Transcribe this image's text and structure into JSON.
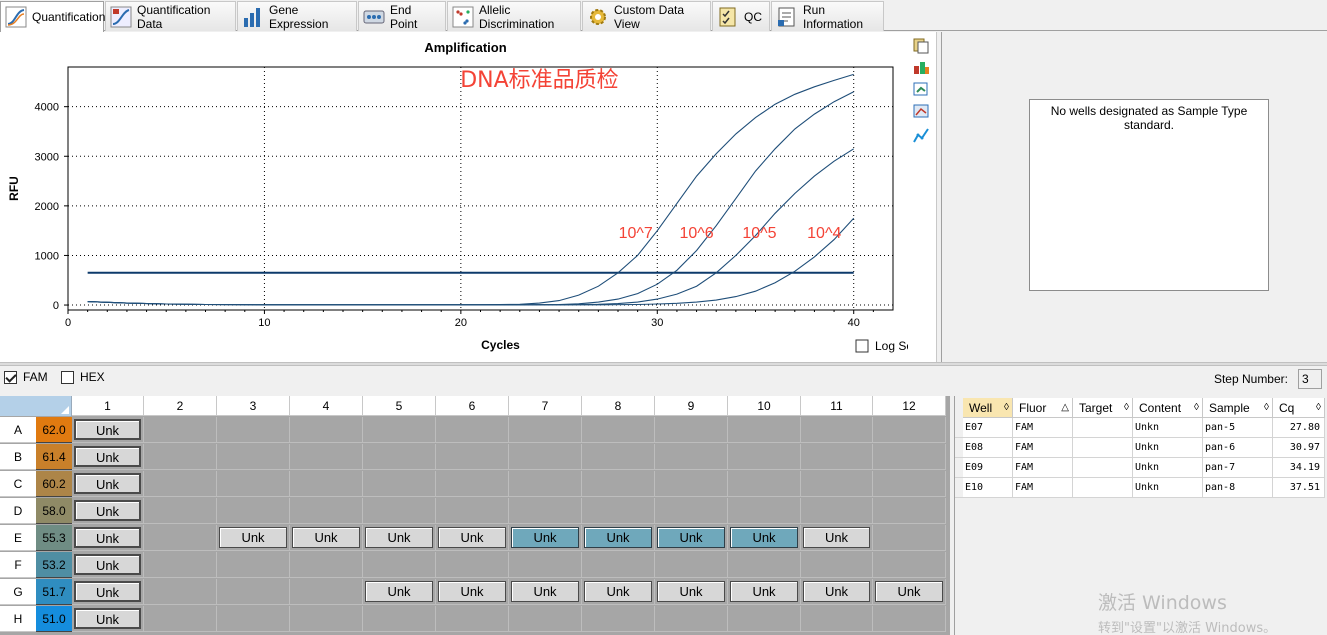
{
  "tabs": [
    {
      "label": "Quantification",
      "icon": "amplification-curve-icon",
      "active": true
    },
    {
      "label": "Quantification Data",
      "icon": "quantification-data-icon"
    },
    {
      "label": "Gene Expression",
      "icon": "bar-chart-icon"
    },
    {
      "label": "End Point",
      "icon": "end-point-icon"
    },
    {
      "label": "Allelic Discrimination",
      "icon": "scatter-plot-icon"
    },
    {
      "label": "Custom Data View",
      "icon": "gear-icon"
    },
    {
      "label": "QC",
      "icon": "checklist-icon"
    },
    {
      "label": "Run Information",
      "icon": "document-icon"
    }
  ],
  "chart_data": {
    "type": "line",
    "title": "Amplification",
    "xlabel": "Cycles",
    "ylabel": "RFU",
    "xlim": [
      0,
      42
    ],
    "ylim": [
      -100,
      4800
    ],
    "x_ticks": [
      0,
      10,
      20,
      30,
      40
    ],
    "y_ticks": [
      0,
      1000,
      2000,
      3000,
      4000
    ],
    "grid": true,
    "annotation_title": "DNA标准品质检",
    "threshold": 650,
    "series": [
      {
        "name": "10^7",
        "x": [
          1,
          3,
          5,
          7,
          10,
          13,
          16,
          19,
          21,
          23,
          24,
          25,
          26,
          27,
          28,
          29,
          30,
          31,
          32,
          33,
          34,
          35,
          36,
          37,
          38,
          39,
          40
        ],
        "y": [
          70,
          40,
          20,
          10,
          5,
          5,
          5,
          5,
          5,
          15,
          40,
          90,
          200,
          380,
          650,
          1000,
          1500,
          2050,
          2600,
          3050,
          3450,
          3780,
          4050,
          4250,
          4400,
          4530,
          4650
        ]
      },
      {
        "name": "10^6",
        "x": [
          1,
          3,
          5,
          7,
          10,
          13,
          16,
          19,
          21,
          23,
          25,
          26,
          27,
          28,
          29,
          30,
          31,
          32,
          33,
          34,
          35,
          36,
          37,
          38,
          39,
          40
        ],
        "y": [
          70,
          40,
          20,
          10,
          5,
          5,
          5,
          5,
          5,
          5,
          10,
          25,
          60,
          120,
          230,
          420,
          700,
          1100,
          1600,
          2150,
          2700,
          3150,
          3550,
          3850,
          4100,
          4300
        ]
      },
      {
        "name": "10^5",
        "x": [
          1,
          3,
          5,
          7,
          10,
          13,
          16,
          19,
          21,
          23,
          25,
          27,
          28,
          29,
          30,
          31,
          32,
          33,
          34,
          35,
          36,
          37,
          38,
          39,
          40
        ],
        "y": [
          70,
          40,
          20,
          10,
          5,
          5,
          5,
          5,
          5,
          5,
          5,
          15,
          30,
          60,
          120,
          220,
          380,
          650,
          1000,
          1400,
          1850,
          2250,
          2600,
          2900,
          3150
        ]
      },
      {
        "name": "10^4",
        "x": [
          1,
          3,
          5,
          7,
          10,
          13,
          16,
          19,
          21,
          23,
          25,
          27,
          29,
          30,
          31,
          32,
          33,
          34,
          35,
          36,
          37,
          38,
          39,
          40
        ],
        "y": [
          70,
          40,
          20,
          10,
          5,
          5,
          5,
          5,
          5,
          5,
          5,
          5,
          10,
          20,
          35,
          60,
          100,
          170,
          280,
          450,
          680,
          970,
          1320,
          1750
        ]
      }
    ],
    "curve_labels": [
      "10^7",
      "10^6",
      "10^5",
      "10^4"
    ],
    "log_scale_label": "Log Scale",
    "log_scale_checked": false
  },
  "colors": {
    "curve": "#1f4e79",
    "threshold": "#0d3a6b",
    "annotation": "#f44336"
  },
  "side_tools": [
    "copy-icon",
    "export-icon",
    "refresh-icon",
    "zoom-icon",
    "chart-settings-icon"
  ],
  "std_message": "No wells designated as Sample Type standard.",
  "fluors": [
    {
      "label": "FAM",
      "checked": true
    },
    {
      "label": "HEX",
      "checked": false
    }
  ],
  "step": {
    "label": "Step Number:",
    "value": "3"
  },
  "plate": {
    "columns": [
      "1",
      "2",
      "3",
      "4",
      "5",
      "6",
      "7",
      "8",
      "9",
      "10",
      "11",
      "12"
    ],
    "rows": [
      {
        "label": "A",
        "temp": "62.0",
        "color": "#e07a10",
        "wells": [
          "Unk",
          "",
          "",
          "",
          "",
          "",
          "",
          "",
          "",
          "",
          "",
          ""
        ]
      },
      {
        "label": "B",
        "temp": "61.4",
        "color": "#c9802a",
        "wells": [
          "Unk",
          "",
          "",
          "",
          "",
          "",
          "",
          "",
          "",
          "",
          "",
          ""
        ]
      },
      {
        "label": "C",
        "temp": "60.2",
        "color": "#ad8548",
        "wells": [
          "Unk",
          "",
          "",
          "",
          "",
          "",
          "",
          "",
          "",
          "",
          "",
          ""
        ]
      },
      {
        "label": "D",
        "temp": "58.0",
        "color": "#8f8a66",
        "wells": [
          "Unk",
          "",
          "",
          "",
          "",
          "",
          "",
          "",
          "",
          "",
          "",
          ""
        ]
      },
      {
        "label": "E",
        "temp": "55.3",
        "color": "#6f8d84",
        "wells": [
          "Unk",
          "",
          "Unk",
          "Unk",
          "Unk",
          "Unk",
          "Unk",
          "Unk",
          "Unk",
          "Unk",
          "Unk",
          ""
        ],
        "selected": [
          6,
          7,
          8,
          9
        ]
      },
      {
        "label": "F",
        "temp": "53.2",
        "color": "#4f8ea3",
        "wells": [
          "Unk",
          "",
          "",
          "",
          "",
          "",
          "",
          "",
          "",
          "",
          "",
          ""
        ]
      },
      {
        "label": "G",
        "temp": "51.7",
        "color": "#2f8dc0",
        "wells": [
          "Unk",
          "",
          "",
          "",
          "Unk",
          "Unk",
          "Unk",
          "Unk",
          "Unk",
          "Unk",
          "Unk",
          "Unk"
        ]
      },
      {
        "label": "H",
        "temp": "51.0",
        "color": "#158ddd",
        "wells": [
          "Unk",
          "",
          "",
          "",
          "",
          "",
          "",
          "",
          "",
          "",
          "",
          ""
        ]
      }
    ]
  },
  "table": {
    "headers": [
      "Well",
      "Fluor",
      "Target",
      "Content",
      "Sample",
      "Cq"
    ],
    "sort_glyphs": [
      "◊",
      "△",
      "◊",
      "◊",
      "◊",
      "◊"
    ],
    "rows": [
      [
        "E07",
        "FAM",
        "",
        "Unkn",
        "pan-5",
        "27.80"
      ],
      [
        "E08",
        "FAM",
        "",
        "Unkn",
        "pan-6",
        "30.97"
      ],
      [
        "E09",
        "FAM",
        "",
        "Unkn",
        "pan-7",
        "34.19"
      ],
      [
        "E10",
        "FAM",
        "",
        "Unkn",
        "pan-8",
        "37.51"
      ]
    ]
  },
  "watermark": {
    "line1": "激活 Windows",
    "line2": "转到\"设置\"以激活 Windows。"
  }
}
